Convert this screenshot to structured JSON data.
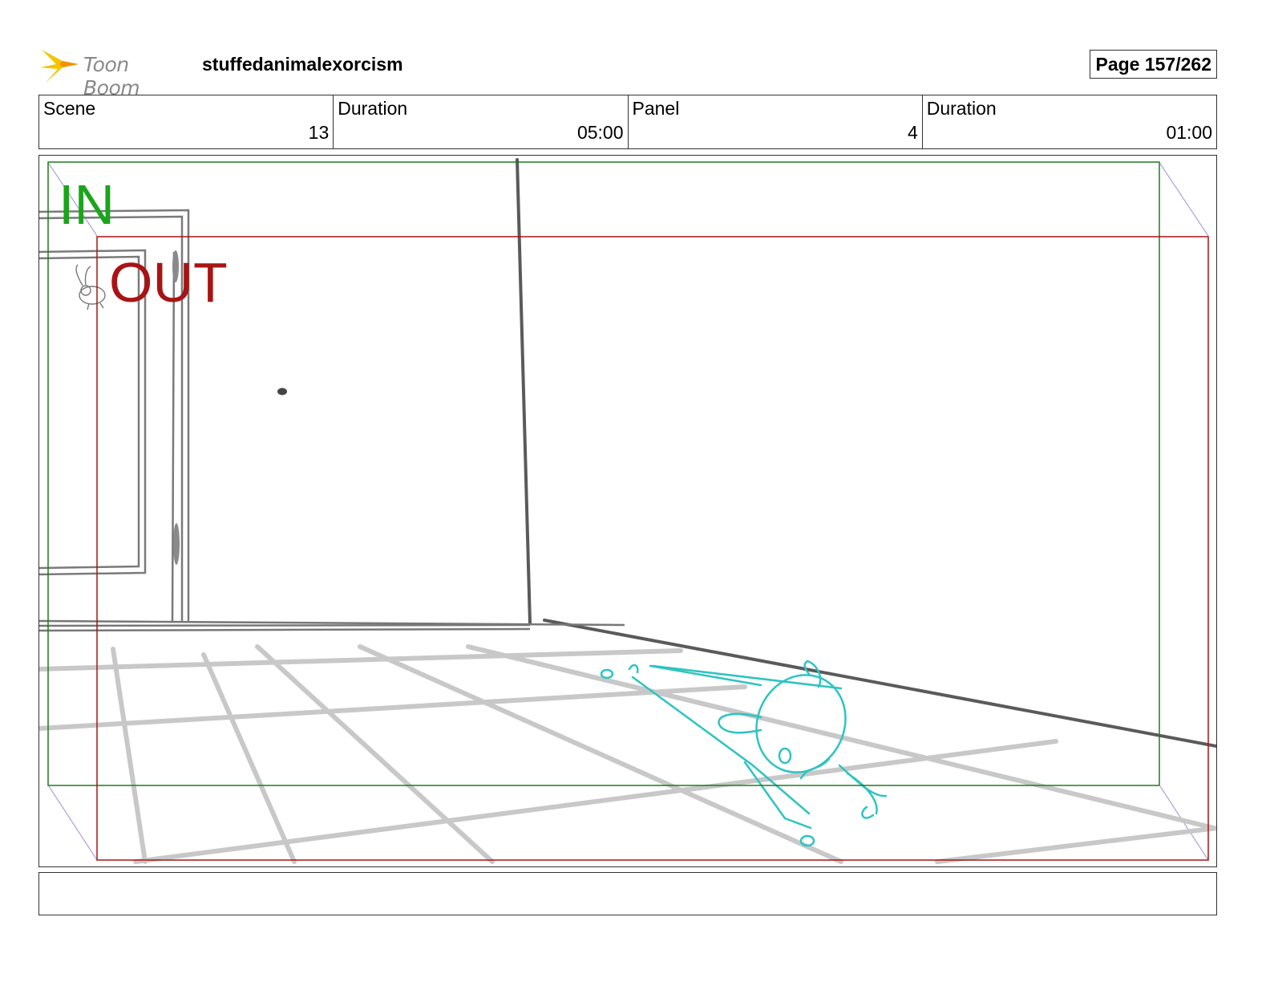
{
  "header": {
    "brand": "Toon Boom",
    "project": "stuffedanimalexorcism",
    "page": "Page 157/262"
  },
  "info": {
    "scene_label": "Scene",
    "scene_value": "13",
    "scene_duration_label": "Duration",
    "scene_duration_value": "05:00",
    "panel_label": "Panel",
    "panel_value": "4",
    "panel_duration_label": "Duration",
    "panel_duration_value": "01:00"
  },
  "frame": {
    "in_label": "IN",
    "out_label": "OUT",
    "in_color": "#1aa51a",
    "out_color": "#a81414",
    "sketch_color": "#2ec4c0"
  },
  "icons": [
    "toon-boom-logo-icon",
    "rabbit-icon"
  ]
}
